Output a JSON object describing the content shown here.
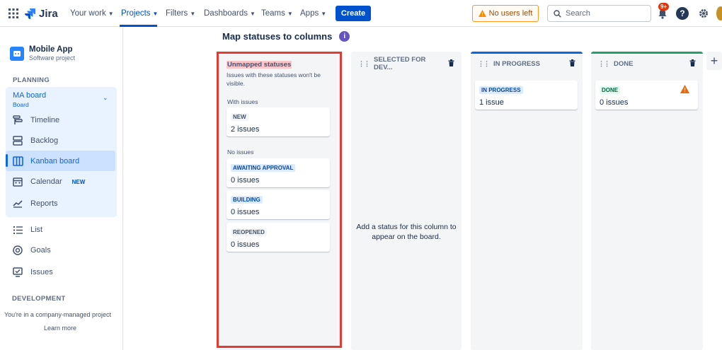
{
  "topnav": {
    "logo": "Jira",
    "items": [
      {
        "label": "Your work"
      },
      {
        "label": "Projects"
      },
      {
        "label": "Filters"
      },
      {
        "label": "Dashboards"
      },
      {
        "label": "Teams"
      },
      {
        "label": "Apps"
      }
    ],
    "active_item": "Projects",
    "create_label": "Create",
    "no_users_label": "No users left",
    "search_placeholder": "Search",
    "notifications_badge": "9+"
  },
  "sidebar": {
    "project_name": "Mobile App",
    "project_type": "Software project",
    "planning_title": "PLANNING",
    "board_name": "MA board",
    "board_sub": "Board",
    "items": [
      {
        "label": "Timeline",
        "icon": "timeline-icon"
      },
      {
        "label": "Backlog",
        "icon": "backlog-icon"
      },
      {
        "label": "Kanban board",
        "icon": "kanban-icon"
      },
      {
        "label": "Calendar",
        "icon": "calendar-icon",
        "tag": "NEW"
      },
      {
        "label": "Reports",
        "icon": "reports-icon"
      },
      {
        "label": "List",
        "icon": "list-icon"
      },
      {
        "label": "Goals",
        "icon": "goals-icon"
      },
      {
        "label": "Issues",
        "icon": "issues-icon"
      }
    ],
    "development_title": "DEVELOPMENT",
    "footer_text": "You're in a company-managed project",
    "learn_more": "Learn more"
  },
  "main": {
    "title": "Map statuses to columns",
    "unmapped": {
      "title": "Unmapped statuses",
      "description": "Issues with these statuses won't be visible.",
      "with_issues_label": "With issues",
      "no_issues_label": "No issues",
      "cards": [
        {
          "status": "NEW",
          "count": "2 issues"
        },
        {
          "status": "AWAITING APPROVAL",
          "count": "0 issues"
        },
        {
          "status": "BUILDING",
          "count": "0 issues"
        },
        {
          "status": "REOPENED",
          "count": "0 issues"
        }
      ]
    },
    "columns": [
      {
        "title": "SELECTED FOR DEV...",
        "empty_text": "Add a status for this column to appear on the board."
      },
      {
        "title": "IN PROGRESS",
        "accent": "#0c66e4",
        "card": {
          "status": "IN PROGRESS",
          "count": "1 issue"
        }
      },
      {
        "title": "DONE",
        "accent": "#22a06b",
        "card": {
          "status": "DONE",
          "count": "0 issues"
        }
      }
    ]
  }
}
